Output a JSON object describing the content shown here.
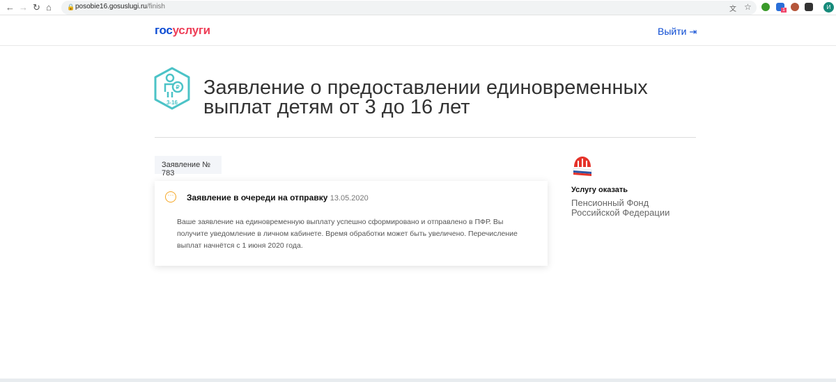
{
  "browser": {
    "url_host": "posobie16.gosuslugi.ru",
    "url_path": "/finish",
    "profile_initial": "И",
    "ext_badge": "1"
  },
  "header": {
    "logo_part1": "гос",
    "logo_part2": "услуги",
    "logout_label": "Выйти"
  },
  "service": {
    "title": "Заявление о предоставлении единовременных выплат детям от 3 до 16 лет",
    "icon_label": "3-16"
  },
  "application": {
    "tab_label": "Заявление № 783",
    "status": "Заявление в очереди на отправку",
    "date": "13.05.2020",
    "message": "Ваше заявление на единовременную выплату успешно сформировано и отправлено в ПФР. Вы получите уведомление в личном кабинете. Время обработки может быть увеличено. Перечисление выплат начнётся с 1 июня 2020 года."
  },
  "provider": {
    "label": "Услугу оказать",
    "name": "Пенсионный Фонд Российской Федерации"
  },
  "colors": {
    "accent": "#0d4cd3",
    "brand_red": "#ee3f58",
    "status": "#f5a623",
    "icon": "#4cc3c7"
  }
}
